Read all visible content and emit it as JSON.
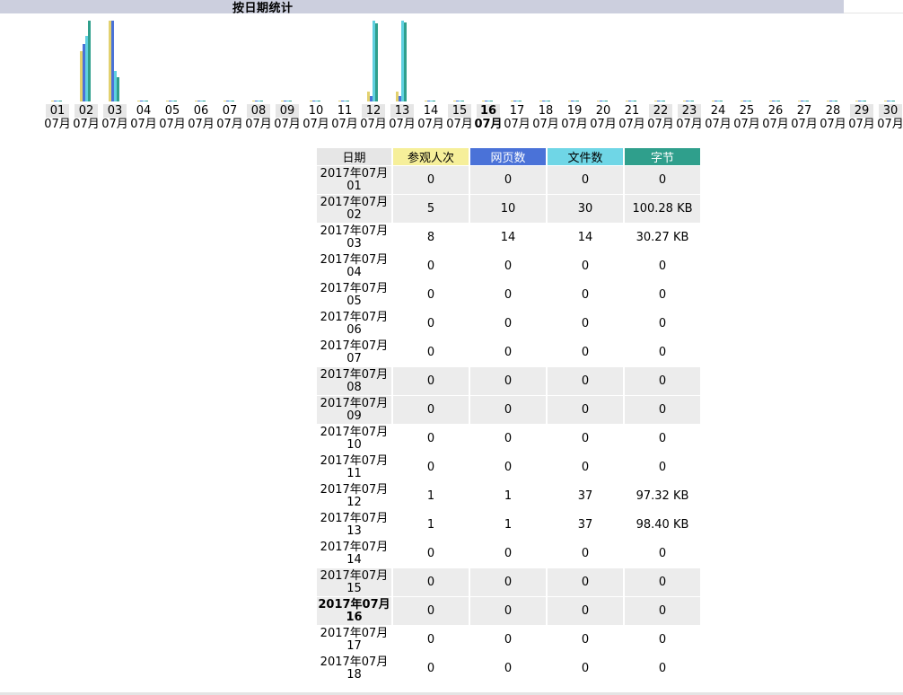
{
  "title": "按日期统计",
  "chart_data": {
    "type": "bar",
    "categories": [
      "01",
      "02",
      "03",
      "04",
      "05",
      "06",
      "07",
      "08",
      "09",
      "10",
      "11",
      "12",
      "13",
      "14",
      "15",
      "16",
      "17",
      "18",
      "19",
      "20",
      "21",
      "22",
      "23",
      "24",
      "25",
      "26",
      "27",
      "28",
      "29",
      "30"
    ],
    "month_label": "07月",
    "today": "16",
    "shaded_days": [
      "01",
      "02",
      "03",
      "08",
      "09",
      "12",
      "13",
      "15",
      "16",
      "22",
      "23",
      "29",
      "30"
    ],
    "series": [
      {
        "name": "参观人次",
        "color": "#e3d16f",
        "values": [
          0,
          5,
          8,
          0,
          0,
          0,
          0,
          0,
          0,
          0,
          0,
          1,
          1,
          0,
          0,
          0,
          0,
          0,
          0,
          0,
          0,
          0,
          0,
          0,
          0,
          0,
          0,
          0,
          0,
          0
        ]
      },
      {
        "name": "网页数",
        "color": "#4a72d8",
        "values": [
          0,
          10,
          14,
          0,
          0,
          0,
          0,
          0,
          0,
          0,
          0,
          1,
          1,
          0,
          0,
          0,
          0,
          0,
          0,
          0,
          0,
          0,
          0,
          0,
          0,
          0,
          0,
          0,
          0,
          0
        ]
      },
      {
        "name": "文件数",
        "color": "#5fd0e0",
        "values": [
          0,
          30,
          14,
          0,
          0,
          0,
          0,
          0,
          0,
          0,
          0,
          37,
          37,
          0,
          0,
          0,
          0,
          0,
          0,
          0,
          0,
          0,
          0,
          0,
          0,
          0,
          0,
          0,
          0,
          0
        ]
      },
      {
        "name": "字节",
        "color": "#2f9f8c",
        "values": [
          0,
          100.28,
          30.27,
          0,
          0,
          0,
          0,
          0,
          0,
          0,
          0,
          97.32,
          98.4,
          0,
          0,
          0,
          0,
          0,
          0,
          0,
          0,
          0,
          0,
          0,
          0,
          0,
          0,
          0,
          0,
          0
        ]
      }
    ]
  },
  "table": {
    "headers": {
      "date": "日期",
      "visits": "参观人次",
      "pages": "网页数",
      "files": "文件数",
      "bytes": "字节"
    },
    "rows": [
      {
        "date_a": "2017年07月",
        "date_b": "01",
        "visits": "0",
        "pages": "0",
        "files": "0",
        "bytes": "0",
        "shade": true
      },
      {
        "date_a": "2017年07月",
        "date_b": "02",
        "visits": "5",
        "pages": "10",
        "files": "30",
        "bytes": "100.28 KB",
        "shade": true
      },
      {
        "date_a": "2017年07月",
        "date_b": "03",
        "visits": "8",
        "pages": "14",
        "files": "14",
        "bytes": "30.27 KB",
        "shade": false
      },
      {
        "date_a": "2017年07月",
        "date_b": "04",
        "visits": "0",
        "pages": "0",
        "files": "0",
        "bytes": "0",
        "shade": false
      },
      {
        "date_a": "2017年07月",
        "date_b": "05",
        "visits": "0",
        "pages": "0",
        "files": "0",
        "bytes": "0",
        "shade": false
      },
      {
        "date_a": "2017年07月",
        "date_b": "06",
        "visits": "0",
        "pages": "0",
        "files": "0",
        "bytes": "0",
        "shade": false
      },
      {
        "date_a": "2017年07月",
        "date_b": "07",
        "visits": "0",
        "pages": "0",
        "files": "0",
        "bytes": "0",
        "shade": false
      },
      {
        "date_a": "2017年07月",
        "date_b": "08",
        "visits": "0",
        "pages": "0",
        "files": "0",
        "bytes": "0",
        "shade": true
      },
      {
        "date_a": "2017年07月",
        "date_b": "09",
        "visits": "0",
        "pages": "0",
        "files": "0",
        "bytes": "0",
        "shade": true
      },
      {
        "date_a": "2017年07月",
        "date_b": "10",
        "visits": "0",
        "pages": "0",
        "files": "0",
        "bytes": "0",
        "shade": false
      },
      {
        "date_a": "2017年07月",
        "date_b": "11",
        "visits": "0",
        "pages": "0",
        "files": "0",
        "bytes": "0",
        "shade": false
      },
      {
        "date_a": "2017年07月",
        "date_b": "12",
        "visits": "1",
        "pages": "1",
        "files": "37",
        "bytes": "97.32 KB",
        "shade": false
      },
      {
        "date_a": "2017年07月",
        "date_b": "13",
        "visits": "1",
        "pages": "1",
        "files": "37",
        "bytes": "98.40 KB",
        "shade": false
      },
      {
        "date_a": "2017年07月",
        "date_b": "14",
        "visits": "0",
        "pages": "0",
        "files": "0",
        "bytes": "0",
        "shade": false
      },
      {
        "date_a": "2017年07月",
        "date_b": "15",
        "visits": "0",
        "pages": "0",
        "files": "0",
        "bytes": "0",
        "shade": true
      },
      {
        "date_a": "2017年07月",
        "date_b": "16",
        "visits": "0",
        "pages": "0",
        "files": "0",
        "bytes": "0",
        "shade": true,
        "today": true
      },
      {
        "date_a": "2017年07月",
        "date_b": "17",
        "visits": "0",
        "pages": "0",
        "files": "0",
        "bytes": "0",
        "shade": false
      },
      {
        "date_a": "2017年07月",
        "date_b": "18",
        "visits": "0",
        "pages": "0",
        "files": "0",
        "bytes": "0",
        "shade": false
      }
    ]
  }
}
